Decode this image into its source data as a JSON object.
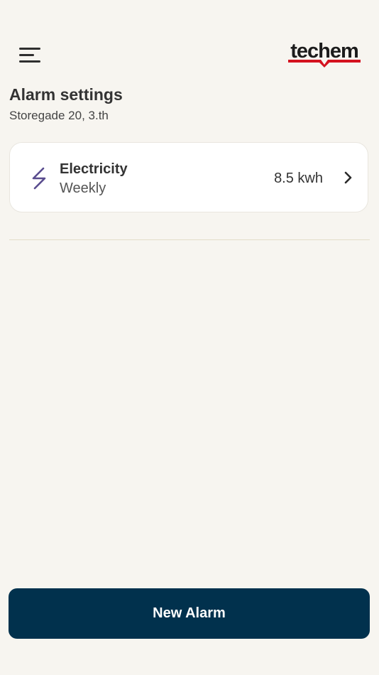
{
  "header": {
    "menu_icon": "hamburger-menu-icon",
    "logo_text": "techem",
    "logo_accent_color": "#d4121f"
  },
  "page": {
    "title": "Alarm settings",
    "subtitle": "Storegade 20, 3.th"
  },
  "alarms": [
    {
      "icon": "lightning-bolt-icon",
      "icon_color": "#5a4d8f",
      "name": "Electricity",
      "frequency": "Weekly",
      "value": "8.5 kwh"
    }
  ],
  "actions": {
    "new_alarm_label": "New Alarm",
    "new_alarm_color": "#01314d"
  }
}
